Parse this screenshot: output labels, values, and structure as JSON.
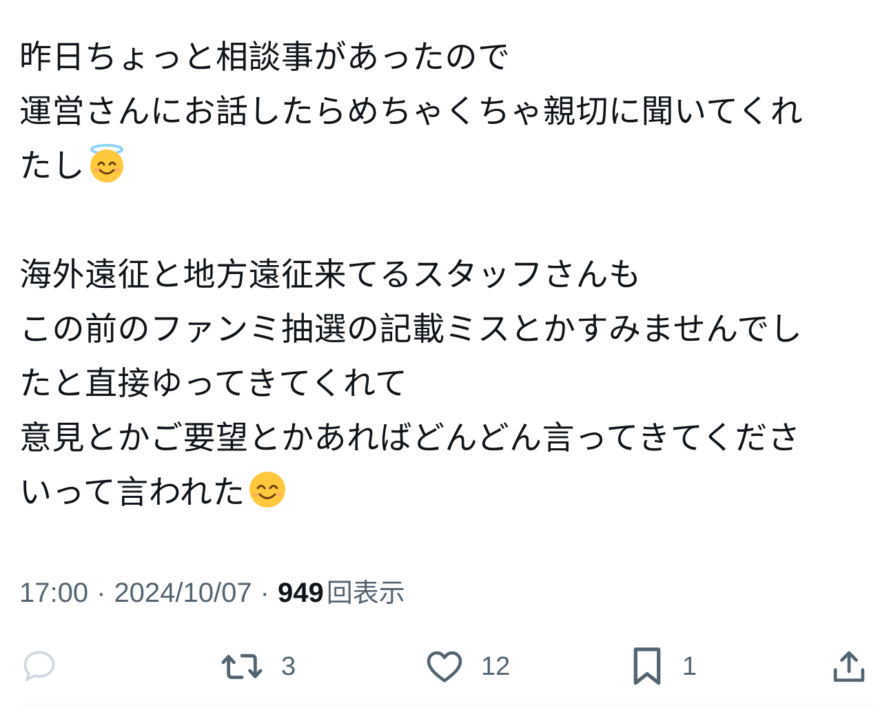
{
  "tweet": {
    "lines": [
      "昨日ちょっと相談事があったので",
      "運営さんにお話したらめちゃくちゃ親切に聞いてくれ",
      "たし",
      "",
      "海外遠征と地方遠征来てるスタッフさんも",
      "この前のファンミ抽選の記載ミスとかすみませんでし",
      "たと直接ゆってきてくれて",
      "意見とかご要望とかあればどんどん言ってきてくださ",
      "いって言われた"
    ],
    "emoji": {
      "line3": "smiling-face-with-halo",
      "line9": "smiling-face-with-smiling-eyes"
    }
  },
  "meta": {
    "time": "17:00",
    "date": "2024/10/07",
    "separator": "·",
    "views_count": "949",
    "views_label": "回表示"
  },
  "actions": {
    "reply_count": "",
    "retweet_count": "3",
    "like_count": "12",
    "bookmark_count": "1"
  },
  "colors": {
    "text": "#0f1419",
    "secondary": "#536471",
    "reply_icon_faded": "#cfd9de",
    "divider": "#eff3f4",
    "emoji_face": "#ffc83d",
    "halo": "#8fd4ff"
  }
}
